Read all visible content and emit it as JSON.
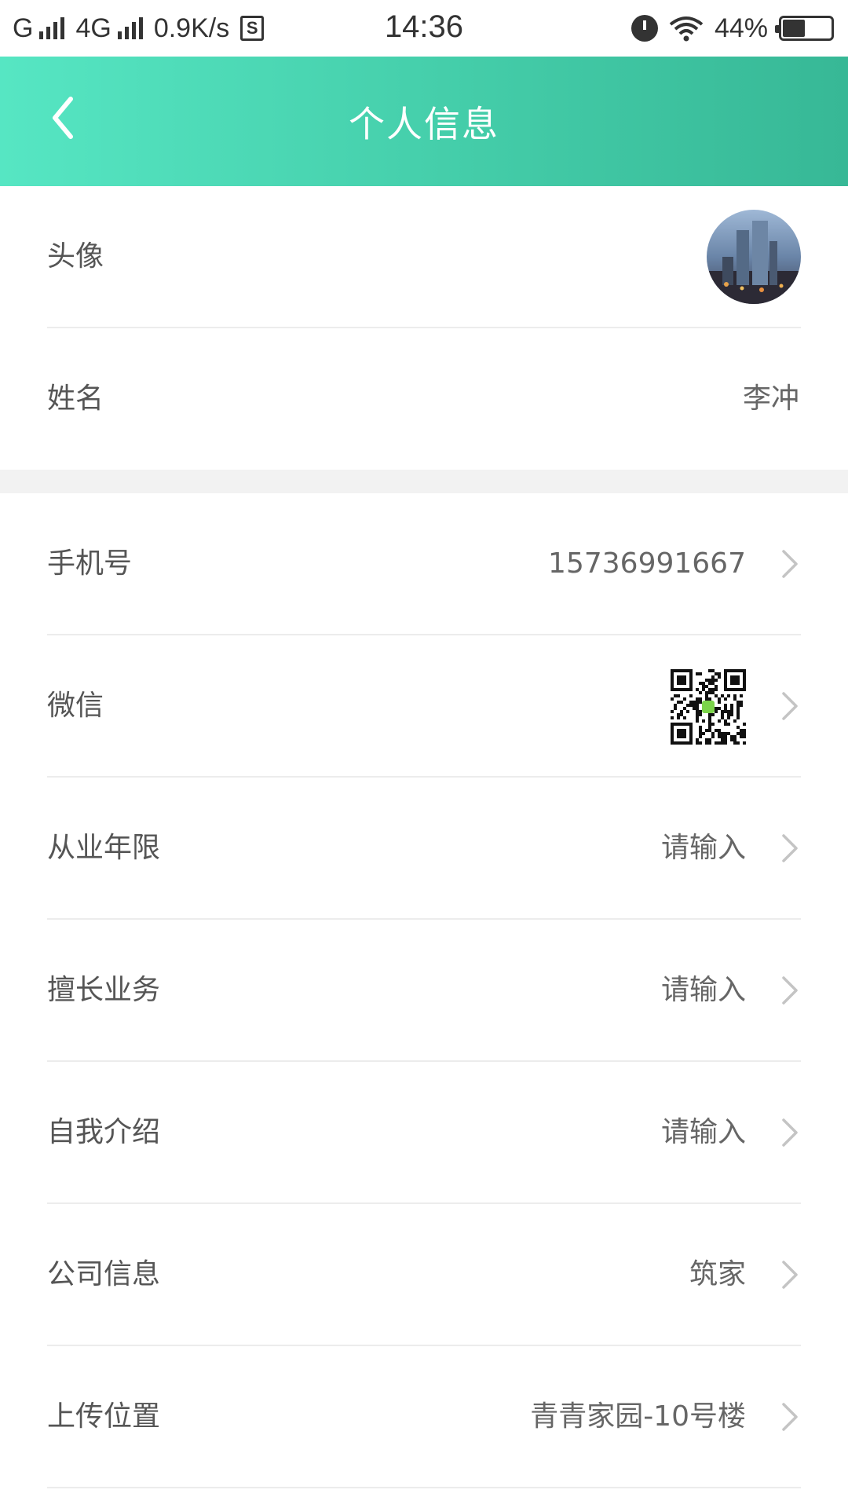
{
  "status_bar": {
    "carrier1": "G",
    "carrier2": "4G",
    "speed": "0.9K/s",
    "sim_badge": "S",
    "time": "14:36",
    "battery": "44%",
    "battery_level": 0.44
  },
  "header": {
    "title": "个人信息"
  },
  "profile": {
    "avatar_label": "头像",
    "name_label": "姓名",
    "name_value": "李冲"
  },
  "details": [
    {
      "label": "手机号",
      "value": "15736991667"
    },
    {
      "label": "微信",
      "value": ""
    },
    {
      "label": "从业年限",
      "value": "请输入"
    },
    {
      "label": "擅长业务",
      "value": "请输入"
    },
    {
      "label": "自我介绍",
      "value": "请输入"
    },
    {
      "label": "公司信息",
      "value": "筑家"
    },
    {
      "label": "上传位置",
      "value": "青青家园-10号楼"
    }
  ],
  "colors": {
    "header_start": "#56e6c3",
    "header_end": "#37b896",
    "text": "#555555",
    "divider": "#ececec"
  },
  "icons": {
    "back": "chevron-left-icon",
    "row_arrow": "chevron-right-icon",
    "wechat_code": "qr-code-icon"
  }
}
